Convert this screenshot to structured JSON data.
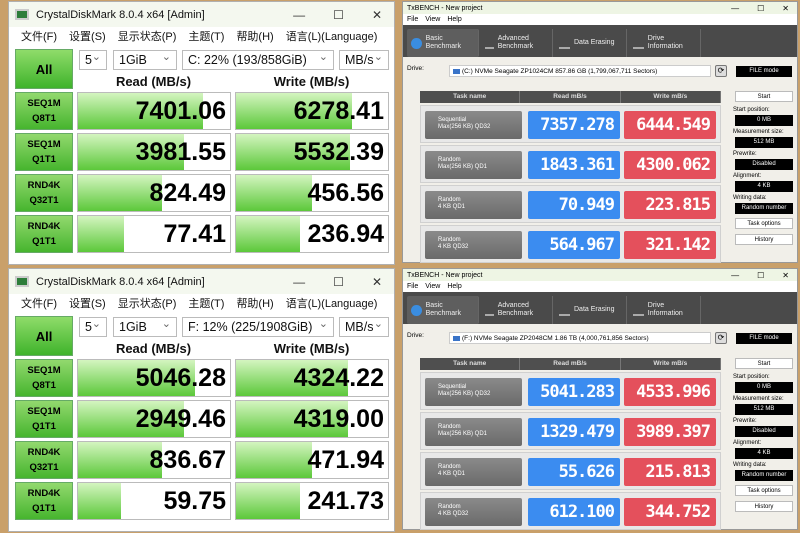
{
  "cdm": [
    {
      "title": "CrystalDiskMark 8.0.4 x64 [Admin]",
      "menu": [
        "文件(F)",
        "设置(S)",
        "显示状态(P)",
        "主题(T)",
        "帮助(H)",
        "语言(L)(Language)"
      ],
      "all": "All",
      "count": "5",
      "size": "1GiB",
      "drive": "C: 22% (193/858GiB)",
      "unit": "MB/s",
      "read_header": "Read (MB/s)",
      "write_header": "Write (MB/s)",
      "rows": [
        {
          "l1": "SEQ1M",
          "l2": "Q8T1",
          "read": "7401.06",
          "write": "6278.41",
          "read_fill": 0.82,
          "write_fill": 0.76
        },
        {
          "l1": "SEQ1M",
          "l2": "Q1T1",
          "read": "3981.55",
          "write": "5532.39",
          "read_fill": 0.7,
          "write_fill": 0.75
        },
        {
          "l1": "RND4K",
          "l2": "Q32T1",
          "read": "824.49",
          "write": "456.56",
          "read_fill": 0.55,
          "write_fill": 0.5
        },
        {
          "l1": "RND4K",
          "l2": "Q1T1",
          "read": "77.41",
          "write": "236.94",
          "read_fill": 0.3,
          "write_fill": 0.42
        }
      ]
    },
    {
      "title": "CrystalDiskMark 8.0.4 x64 [Admin]",
      "menu": [
        "文件(F)",
        "设置(S)",
        "显示状态(P)",
        "主题(T)",
        "帮助(H)",
        "语言(L)(Language)"
      ],
      "all": "All",
      "count": "5",
      "size": "1GiB",
      "drive": "F: 12% (225/1908GiB)",
      "unit": "MB/s",
      "read_header": "Read (MB/s)",
      "write_header": "Write (MB/s)",
      "rows": [
        {
          "l1": "SEQ1M",
          "l2": "Q8T1",
          "read": "5046.28",
          "write": "4324.22",
          "read_fill": 0.77,
          "write_fill": 0.74
        },
        {
          "l1": "SEQ1M",
          "l2": "Q1T1",
          "read": "2949.46",
          "write": "4319.00",
          "read_fill": 0.7,
          "write_fill": 0.74
        },
        {
          "l1": "RND4K",
          "l2": "Q32T1",
          "read": "836.67",
          "write": "471.94",
          "read_fill": 0.55,
          "write_fill": 0.5
        },
        {
          "l1": "RND4K",
          "l2": "Q1T1",
          "read": "59.75",
          "write": "241.73",
          "read_fill": 0.28,
          "write_fill": 0.42
        }
      ]
    }
  ],
  "tx": [
    {
      "title": "TxBENCH - New project",
      "menu": [
        "File",
        "View",
        "Help"
      ],
      "tabs": [
        "Basic Benchmark",
        "Advanced Benchmark",
        "Data Erasing",
        "Drive Information"
      ],
      "drive_label": "Drive:",
      "drive": "(C:) NVMe Seagate ZP1024CM  857.86 GB (1,799,067,711 Sectors)",
      "mode": "FILE mode",
      "headers": [
        "Task name",
        "Read mB/s",
        "Write mB/s"
      ],
      "rows": [
        {
          "t1": "Sequential",
          "t2": "Max(256 KB) QD32",
          "read": "7357.278",
          "write": "6444.549"
        },
        {
          "t1": "Random",
          "t2": "Max(256 KB) QD1",
          "read": "1843.361",
          "write": "4300.062"
        },
        {
          "t1": "Random",
          "t2": "4 KB QD1",
          "read": "70.949",
          "write": "223.815"
        },
        {
          "t1": "Random",
          "t2": "4 KB QD32",
          "read": "564.967",
          "write": "321.142"
        }
      ],
      "side": {
        "start": "Start",
        "start_pos_label": "Start position:",
        "start_pos": "0 MB",
        "size_label": "Measurement size:",
        "size": "512 MB",
        "prewrite_label": "Prewrite:",
        "prewrite": "Disabled",
        "align_label": "Alignment:",
        "align": "4 KB",
        "wdata_label": "Writing data:",
        "wdata": "Random number",
        "task_options": "Task options",
        "history": "History"
      }
    },
    {
      "title": "TxBENCH - New project",
      "menu": [
        "File",
        "View",
        "Help"
      ],
      "tabs": [
        "Basic Benchmark",
        "Advanced Benchmark",
        "Data Erasing",
        "Drive Information"
      ],
      "drive_label": "Drive:",
      "drive": "(F:) NVMe Seagate ZP2048CM  1.86 TB (4,000,761,856 Sectors)",
      "mode": "FILE mode",
      "headers": [
        "Task name",
        "Read mB/s",
        "Write mB/s"
      ],
      "rows": [
        {
          "t1": "Sequential",
          "t2": "Max(256 KB) QD32",
          "read": "5041.283",
          "write": "4533.996"
        },
        {
          "t1": "Random",
          "t2": "Max(256 KB) QD1",
          "read": "1329.479",
          "write": "3989.397"
        },
        {
          "t1": "Random",
          "t2": "4 KB QD1",
          "read": "55.626",
          "write": "215.813"
        },
        {
          "t1": "Random",
          "t2": "4 KB QD32",
          "read": "612.100",
          "write": "344.752"
        }
      ],
      "side": {
        "start": "Start",
        "start_pos_label": "Start position:",
        "start_pos": "0 MB",
        "size_label": "Measurement size:",
        "size": "512 MB",
        "prewrite_label": "Prewrite:",
        "prewrite": "Disabled",
        "align_label": "Alignment:",
        "align": "4 KB",
        "wdata_label": "Writing data:",
        "wdata": "Random number",
        "task_options": "Task options",
        "history": "History"
      }
    }
  ]
}
